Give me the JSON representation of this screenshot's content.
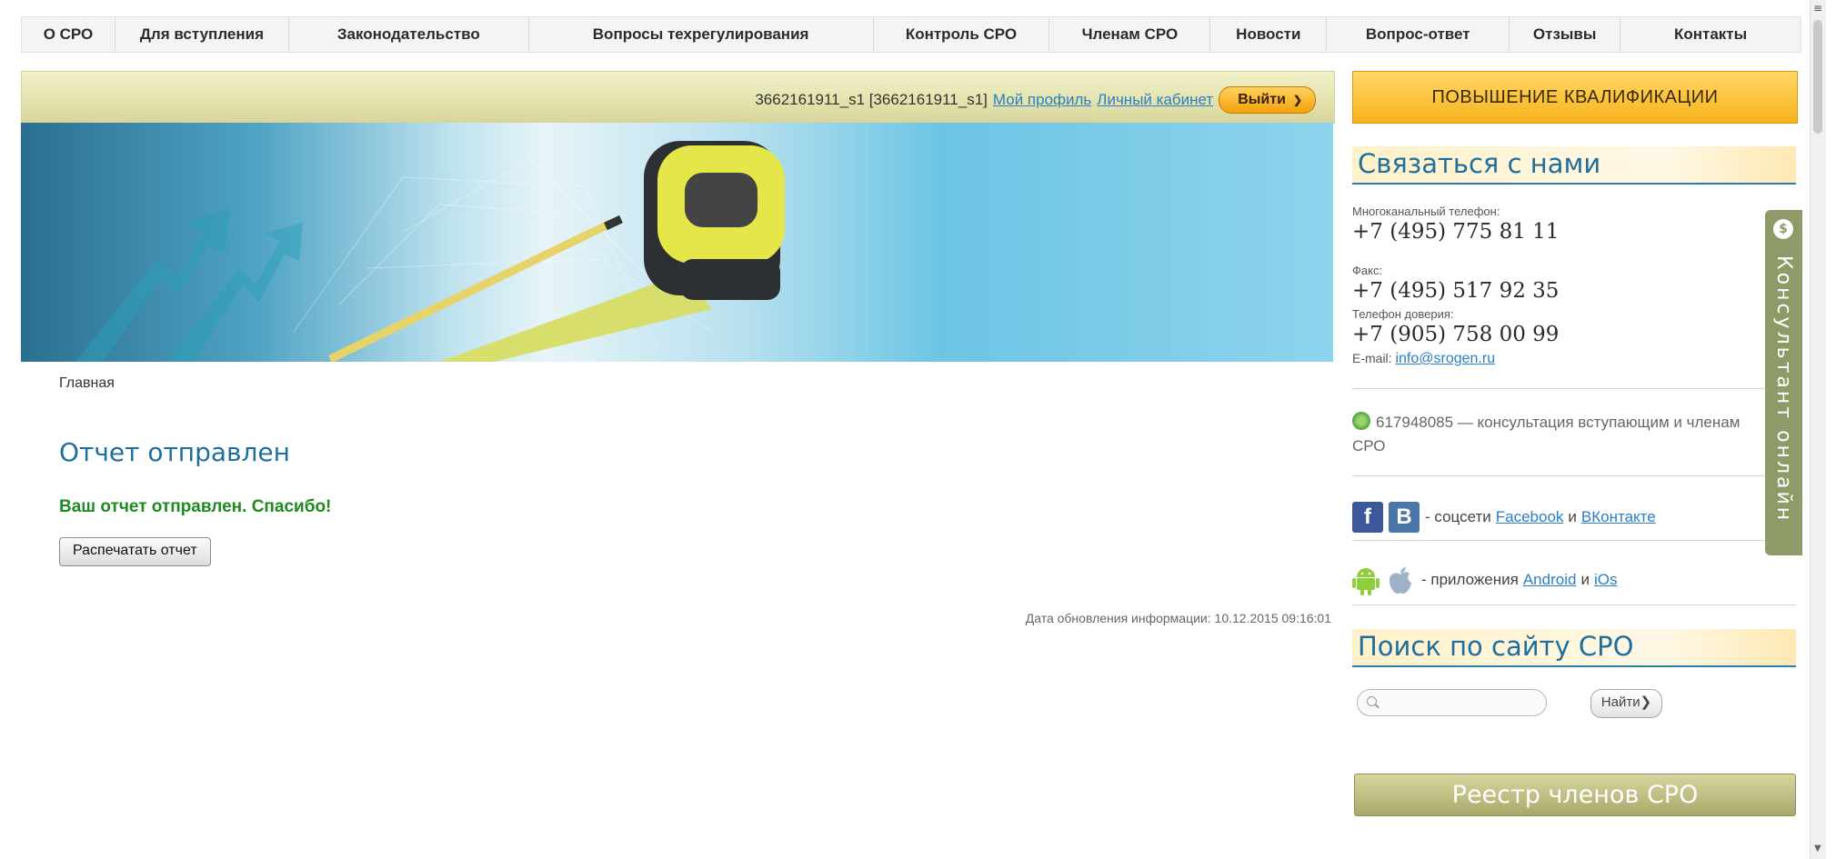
{
  "nav": {
    "items": [
      {
        "label": "О СРО"
      },
      {
        "label": "Для вступления"
      },
      {
        "label": "Законодательство"
      },
      {
        "label": "Вопросы техрегулирования"
      },
      {
        "label": "Контроль СРО"
      },
      {
        "label": "Членам СРО"
      },
      {
        "label": "Новости"
      },
      {
        "label": "Вопрос-ответ"
      },
      {
        "label": "Отзывы"
      },
      {
        "label": "Контакты"
      }
    ]
  },
  "userbar": {
    "user": "3662161911_s1 [3662161911_s1]",
    "profile_link": "Мой профиль",
    "cabinet_link": "Личный кабинет",
    "logout_label": "Выйти"
  },
  "breadcrumb": "Главная",
  "main": {
    "title": "Отчет отправлен",
    "message": "Ваш отчет отправлен. Спасибо!",
    "print_button": "Распечатать отчет",
    "update_date": "Дата обновления информации: 10.12.2015 09:16:01"
  },
  "sidebar": {
    "qualification_button": "ПОВЫШЕНИЕ КВАЛИФИКАЦИИ",
    "contact_heading": "Связаться с нами",
    "phone_label": "Многоканальный телефон:",
    "phone": "+7 (495) 775 81 11",
    "fax_label": "Факс:",
    "fax": "+7 (495) 517 92 35",
    "trust_label": "Телефон доверия:",
    "trust_phone": "+7 (905) 758 00 99",
    "email_label": "E-mail:",
    "email": "info@srogen.ru",
    "icq_text": "617948085 — консультация вступающим и членам СРО",
    "social_fb_letter": "f",
    "social_vk_letter": "B",
    "social_text": "- соцсети",
    "social_fb_link": "Facebook",
    "social_and": "и",
    "social_vk_link": "ВКонтакте",
    "apps_text": "- приложения",
    "apps_android_link": "Android",
    "apps_and": "и",
    "apps_ios_link": "iOs",
    "search_heading": "Поиск по сайту СРО",
    "search_placeholder": "",
    "search_button": "Найти",
    "registry_button": "Реестр членов СРО"
  },
  "consultant": {
    "label": "Консультант онлайн"
  },
  "colors": {
    "accent": "#1f6f9e",
    "success": "#1f8a1f",
    "link": "#2a7fc7",
    "qualification_bg": "#f7b21c",
    "consultant_tab": "#8e9a68"
  }
}
